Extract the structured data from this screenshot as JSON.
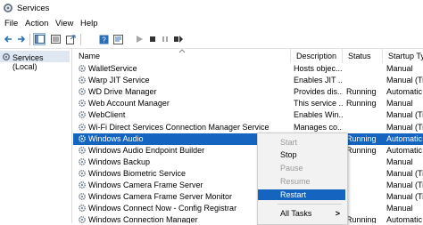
{
  "window": {
    "title": "Services",
    "icon": "services-gear-icon"
  },
  "menubar": {
    "items": [
      "File",
      "Action",
      "View",
      "Help"
    ]
  },
  "toolbar": {
    "icons": [
      "back-arrow-icon",
      "forward-arrow-icon",
      "show-hide-tree-icon",
      "list-icon",
      "export-icon",
      "help-icon",
      "properties-icon",
      "play-icon",
      "stop-icon",
      "pause-icon",
      "restart-icon"
    ]
  },
  "tree": {
    "selected_label": "Services (Local)"
  },
  "table": {
    "columns": [
      "Name",
      "Description",
      "Status",
      "Startup Type"
    ],
    "rows": [
      {
        "name": "WalletService",
        "description": "Hosts objec...",
        "status": "",
        "startup": "Manual"
      },
      {
        "name": "Warp JIT Service",
        "description": "Enables JIT ...",
        "status": "",
        "startup": "Manual (Trig"
      },
      {
        "name": "WD Drive Manager",
        "description": "Provides dis...",
        "status": "Running",
        "startup": "Automatic"
      },
      {
        "name": "Web Account Manager",
        "description": "This service ...",
        "status": "Running",
        "startup": "Manual"
      },
      {
        "name": "WebClient",
        "description": "Enables Win...",
        "status": "",
        "startup": "Manual (Trig"
      },
      {
        "name": "Wi-Fi Direct Services Connection Manager Service",
        "description": "Manages co...",
        "status": "",
        "startup": "Manual (Trig"
      },
      {
        "name": "Windows Audio",
        "description": "",
        "status": "Running",
        "startup": "Automatic",
        "selected": true
      },
      {
        "name": "Windows Audio Endpoint Builder",
        "description": "",
        "status": "Running",
        "startup": "Automatic"
      },
      {
        "name": "Windows Backup",
        "description": "",
        "status": "",
        "startup": "Manual"
      },
      {
        "name": "Windows Biometric Service",
        "description": "",
        "status": "",
        "startup": "Manual (Trig"
      },
      {
        "name": "Windows Camera Frame Server",
        "description": "",
        "status": "",
        "startup": "Manual (Trig"
      },
      {
        "name": "Windows Camera Frame Server Monitor",
        "description": "",
        "status": "",
        "startup": "Manual (Trig"
      },
      {
        "name": "Windows Connect Now - Config Registrar",
        "description": "",
        "status": "",
        "startup": "Manual"
      },
      {
        "name": "Windows Connection Manager",
        "description": "",
        "status": "Running",
        "startup": "Automatic"
      }
    ]
  },
  "context_menu": {
    "items": [
      {
        "label": "Start",
        "disabled": true
      },
      {
        "label": "Stop",
        "disabled": false
      },
      {
        "label": "Pause",
        "disabled": true
      },
      {
        "label": "Resume",
        "disabled": true
      },
      {
        "label": "Restart",
        "disabled": false,
        "highlighted": true
      },
      {
        "label": "All Tasks",
        "disabled": false,
        "submenu_arrow": ">"
      }
    ]
  },
  "colors": {
    "selection": "#1565c0",
    "tree_selection": "#dfe8f2",
    "menu_bg": "#f2f2f2"
  }
}
